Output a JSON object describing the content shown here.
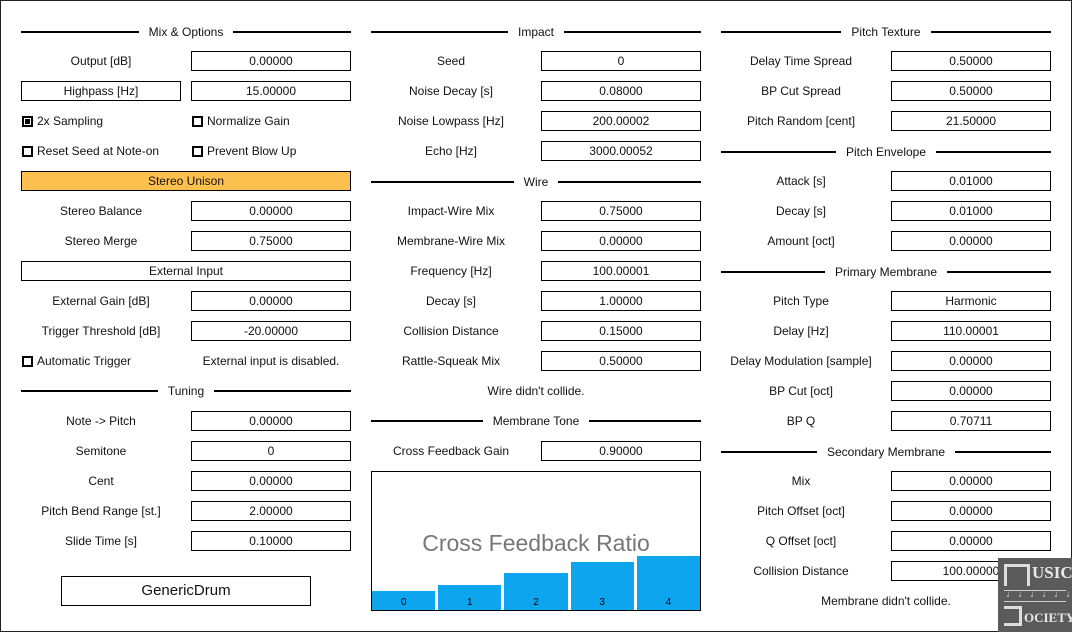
{
  "plugin_name": "GenericDrum",
  "columns": {
    "mix": {
      "title": "Mix & Options",
      "output": {
        "label": "Output [dB]",
        "value": "0.00000"
      },
      "highpass": {
        "label": "Highpass [Hz]",
        "value": "15.00000"
      },
      "checks": [
        {
          "label": "2x Sampling",
          "checked": true
        },
        {
          "label": "Normalize Gain",
          "checked": false
        },
        {
          "label": "Reset Seed at Note-on",
          "checked": false
        },
        {
          "label": "Prevent Blow Up",
          "checked": false
        }
      ],
      "stereo_unison_label": "Stereo Unison",
      "stereo_balance": {
        "label": "Stereo Balance",
        "value": "0.00000"
      },
      "stereo_merge": {
        "label": "Stereo Merge",
        "value": "0.75000"
      },
      "external_input_label": "External Input",
      "external_gain": {
        "label": "External Gain [dB]",
        "value": "0.00000"
      },
      "trigger_threshold": {
        "label": "Trigger Threshold [dB]",
        "value": "-20.00000"
      },
      "automatic_trigger": {
        "label": "Automatic Trigger",
        "checked": false
      },
      "external_status": "External input is disabled."
    },
    "tuning": {
      "title": "Tuning",
      "rows": [
        {
          "label": "Note -> Pitch",
          "value": "0.00000"
        },
        {
          "label": "Semitone",
          "value": "0"
        },
        {
          "label": "Cent",
          "value": "0.00000"
        },
        {
          "label": "Pitch Bend Range [st.]",
          "value": "2.00000"
        },
        {
          "label": "Slide Time [s]",
          "value": "0.10000"
        }
      ]
    },
    "impact": {
      "title": "Impact",
      "rows": [
        {
          "label": "Seed",
          "value": "0"
        },
        {
          "label": "Noise Decay [s]",
          "value": "0.08000"
        },
        {
          "label": "Noise Lowpass [Hz]",
          "value": "200.00002"
        },
        {
          "label": "Echo [Hz]",
          "value": "3000.00052"
        }
      ]
    },
    "wire": {
      "title": "Wire",
      "rows": [
        {
          "label": "Impact-Wire Mix",
          "value": "0.75000"
        },
        {
          "label": "Membrane-Wire Mix",
          "value": "0.00000"
        },
        {
          "label": "Frequency [Hz]",
          "value": "100.00001"
        },
        {
          "label": "Decay [s]",
          "value": "1.00000"
        },
        {
          "label": "Collision Distance",
          "value": "0.15000"
        },
        {
          "label": "Rattle-Squeak Mix",
          "value": "0.50000"
        }
      ],
      "status": "Wire didn't collide."
    },
    "membrane_tone": {
      "title": "Membrane Tone",
      "cross_feedback_gain": {
        "label": "Cross Feedback Gain",
        "value": "0.90000"
      }
    },
    "pitch_texture": {
      "title": "Pitch Texture",
      "rows": [
        {
          "label": "Delay Time Spread",
          "value": "0.50000"
        },
        {
          "label": "BP Cut Spread",
          "value": "0.50000"
        },
        {
          "label": "Pitch Random [cent]",
          "value": "21.50000"
        }
      ]
    },
    "pitch_envelope": {
      "title": "Pitch Envelope",
      "rows": [
        {
          "label": "Attack [s]",
          "value": "0.01000"
        },
        {
          "label": "Decay [s]",
          "value": "0.01000"
        },
        {
          "label": "Amount [oct]",
          "value": "0.00000"
        }
      ]
    },
    "primary_membrane": {
      "title": "Primary Membrane",
      "rows": [
        {
          "label": "Pitch Type",
          "value": "Harmonic"
        },
        {
          "label": "Delay [Hz]",
          "value": "110.00001"
        },
        {
          "label": "Delay Modulation [sample]",
          "value": "0.00000"
        },
        {
          "label": "BP Cut [oct]",
          "value": "0.00000"
        },
        {
          "label": "BP Q",
          "value": "0.70711"
        }
      ]
    },
    "secondary_membrane": {
      "title": "Secondary Membrane",
      "rows": [
        {
          "label": "Mix",
          "value": "0.00000"
        },
        {
          "label": "Pitch Offset [oct]",
          "value": "0.00000"
        },
        {
          "label": "Q Offset [oct]",
          "value": "0.00000"
        },
        {
          "label": "Collision Distance",
          "value": "100.00000"
        }
      ],
      "status": "Membrane didn't collide."
    }
  },
  "chart_data": {
    "type": "bar",
    "title": "Cross Feedback Ratio",
    "categories": [
      "0",
      "1",
      "2",
      "3",
      "4"
    ],
    "values": [
      0.14,
      0.18,
      0.27,
      0.35,
      0.39
    ],
    "ylim": [
      0,
      1
    ],
    "xlabel": "",
    "ylabel": "",
    "color": "#0ea5ef"
  },
  "logo": {
    "line1": "USIC",
    "line2": "OCIETY",
    "notes": "♩♩♩♩♩♩"
  },
  "colors": {
    "accent_orange": "#fcc04e",
    "bar_blue": "#0ea5ef"
  }
}
